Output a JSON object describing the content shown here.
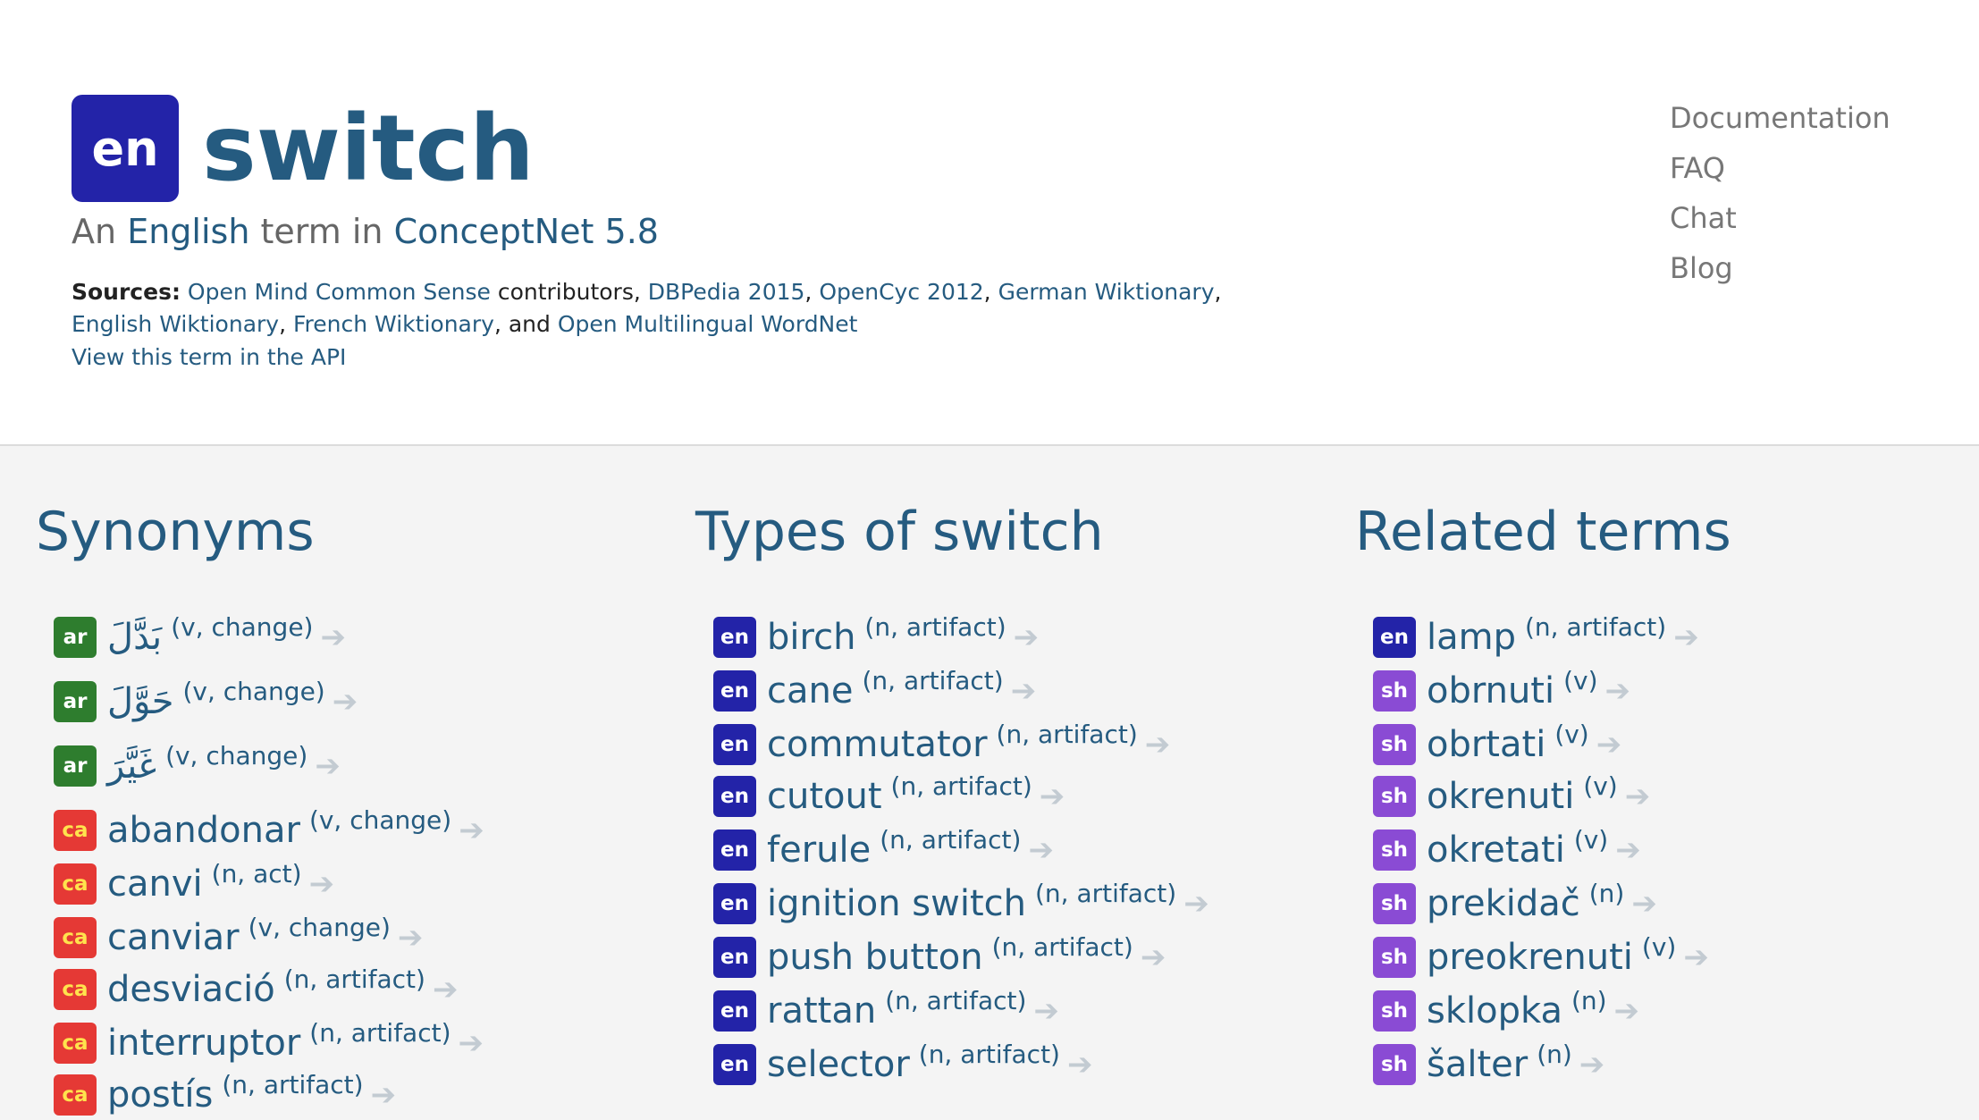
{
  "header": {
    "lang_code": "en",
    "term": "switch",
    "subtitle": {
      "prefix": "An",
      "language": "English",
      "middle": "term in",
      "project": "ConceptNet 5.8"
    },
    "sources_label": "Sources:",
    "sources": [
      {
        "link": "Open Mind Common Sense",
        "after": " contributors, "
      },
      {
        "link": "DBPedia 2015",
        "after": ", "
      },
      {
        "link": "OpenCyc 2012",
        "after": ", "
      },
      {
        "link": "German Wiktionary",
        "after": ", "
      },
      {
        "link": "English Wiktionary",
        "after": ", "
      },
      {
        "link": "French Wiktionary",
        "after": ", and "
      },
      {
        "link": "Open Multilingual WordNet",
        "after": ""
      }
    ],
    "api_link": "View this term in the API"
  },
  "nav": [
    "Documentation",
    "FAQ",
    "Chat",
    "Blog"
  ],
  "columns": [
    {
      "heading": "Synonyms",
      "rows": [
        {
          "lang": "ar",
          "word": "بَدَّلَ",
          "meta": "(v, change)",
          "arrow": "➔"
        },
        {
          "lang": "ar",
          "word": "حَوَّلَ",
          "meta": "(v, change)",
          "arrow": "➔"
        },
        {
          "lang": "ar",
          "word": "غَيَّرَ",
          "meta": "(v, change)",
          "arrow": "➔"
        },
        {
          "lang": "ca",
          "word": "abandonar",
          "meta": "(v, change)",
          "arrow": "➔"
        },
        {
          "lang": "ca",
          "word": "canvi",
          "meta": "(n, act)",
          "arrow": "➔"
        },
        {
          "lang": "ca",
          "word": "canviar",
          "meta": "(v, change)",
          "arrow": "➔"
        },
        {
          "lang": "ca",
          "word": "desviació",
          "meta": "(n, artifact)",
          "arrow": "➔"
        },
        {
          "lang": "ca",
          "word": "interruptor",
          "meta": "(n, artifact)",
          "arrow": "➔"
        },
        {
          "lang": "ca",
          "word": "postís",
          "meta": "(n, artifact)",
          "arrow": "➔"
        }
      ]
    },
    {
      "heading": "Types of switch",
      "rows": [
        {
          "lang": "en",
          "word": "birch",
          "meta": "(n, artifact)",
          "arrow": "➔"
        },
        {
          "lang": "en",
          "word": "cane",
          "meta": "(n, artifact)",
          "arrow": "➔"
        },
        {
          "lang": "en",
          "word": "commutator",
          "meta": "(n, artifact)",
          "arrow": "➔"
        },
        {
          "lang": "en",
          "word": "cutout",
          "meta": "(n, artifact)",
          "arrow": "➔"
        },
        {
          "lang": "en",
          "word": "ferule",
          "meta": "(n, artifact)",
          "arrow": "➔"
        },
        {
          "lang": "en",
          "word": "ignition switch",
          "meta": "(n, artifact)",
          "arrow": "➔"
        },
        {
          "lang": "en",
          "word": "push button",
          "meta": "(n, artifact)",
          "arrow": "➔"
        },
        {
          "lang": "en",
          "word": "rattan",
          "meta": "(n, artifact)",
          "arrow": "➔"
        },
        {
          "lang": "en",
          "word": "selector",
          "meta": "(n, artifact)",
          "arrow": "➔"
        }
      ]
    },
    {
      "heading": "Related terms",
      "rows": [
        {
          "lang": "en",
          "word": "lamp",
          "meta": "(n, artifact)",
          "arrow": "➔"
        },
        {
          "lang": "sh",
          "word": "obrnuti",
          "meta": "(v)",
          "arrow": "➔"
        },
        {
          "lang": "sh",
          "word": "obrtati",
          "meta": "(v)",
          "arrow": "➔"
        },
        {
          "lang": "sh",
          "word": "okrenuti",
          "meta": "(v)",
          "arrow": "➔"
        },
        {
          "lang": "sh",
          "word": "okretati",
          "meta": "(v)",
          "arrow": "➔"
        },
        {
          "lang": "sh",
          "word": "prekidač",
          "meta": "(n)",
          "arrow": "➔"
        },
        {
          "lang": "sh",
          "word": "preokrenuti",
          "meta": "(v)",
          "arrow": "➔"
        },
        {
          "lang": "sh",
          "word": "sklopka",
          "meta": "(n)",
          "arrow": "➔"
        },
        {
          "lang": "sh",
          "word": "šalter",
          "meta": "(n)",
          "arrow": "➔"
        }
      ]
    }
  ]
}
